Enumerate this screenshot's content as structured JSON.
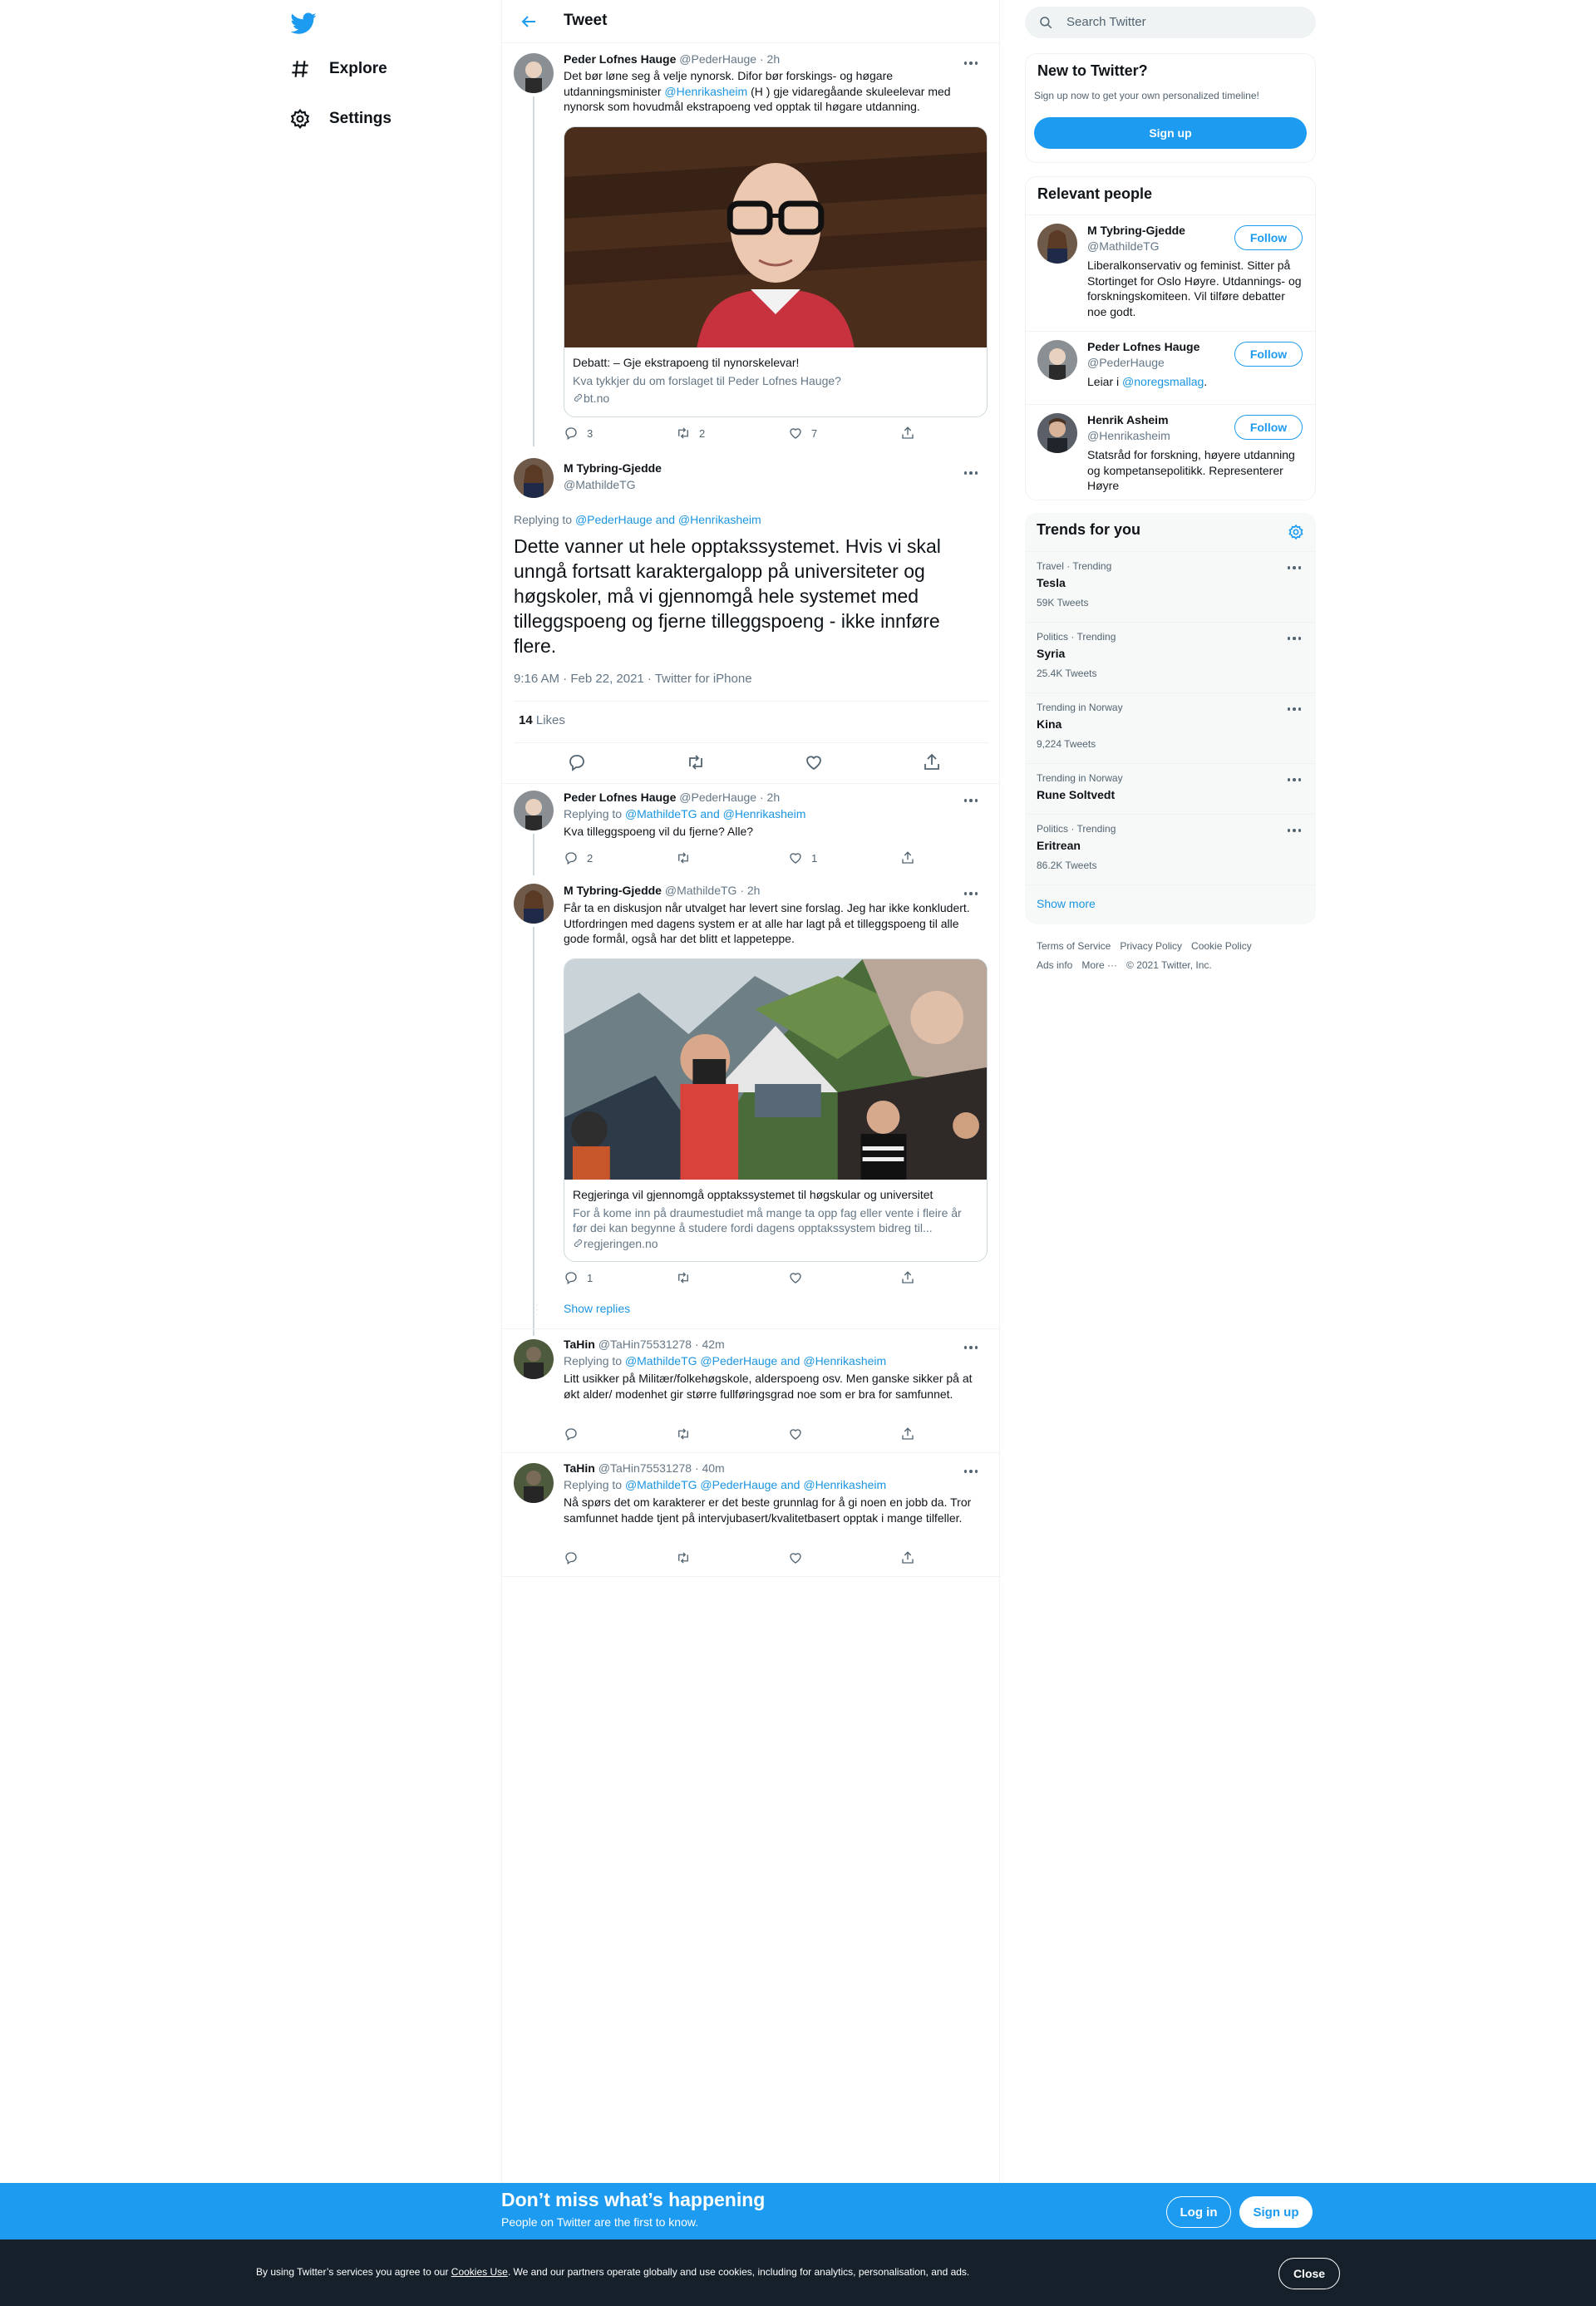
{
  "nav": {
    "logo": "twitter-bird-icon",
    "items": [
      {
        "label": "Explore",
        "icon": "hashtag-icon"
      },
      {
        "label": "Settings",
        "icon": "gear-icon"
      }
    ]
  },
  "header": {
    "title": "Tweet"
  },
  "parent_tweet": {
    "name": "Peder Lofnes Hauge",
    "handle": "@PederHauge",
    "time": "· 2h",
    "text_a": "Det bør løne seg å velje nynorsk. Difor bør forskings- og høgare utdanningsminister ",
    "mention": "@Henrikasheim",
    "text_b": " (H ) gje vidaregåande skuleelevar med nynorsk som hovudmål ekstrapoeng ved opptak til høgare utdanning.",
    "card": {
      "title": "Debatt: – Gje ekstrapoeng til nynorskelevar!",
      "description": "Kva tykkjer du om forslaget til Peder Lofnes Hauge?",
      "domain": "bt.no"
    },
    "replies": "3",
    "retweets": "2",
    "likes": "7"
  },
  "focused_tweet": {
    "name": "M Tybring-Gjedde",
    "handle": "@MathildeTG",
    "replying_prefix": "Replying to ",
    "replying_to": "@PederHauge and @Henrikasheim",
    "text": "Dette vanner ut hele opptakssystemet. Hvis vi skal unngå fortsatt karaktergalopp på universiteter og høgskoler, må vi gjennomgå hele systemet med tilleggspoeng og fjerne tilleggspoeng - ikke innføre flere.",
    "meta": "9:16 AM · Feb 22, 2021 · Twitter for iPhone",
    "likes_count": "14",
    "likes_label": " Likes"
  },
  "reply_1": {
    "name": "Peder Lofnes Hauge",
    "handle": "@PederHauge",
    "time": "· 2h",
    "replying_prefix": "Replying to ",
    "replying_to": "@MathildeTG and @Henrikasheim",
    "text": "Kva tilleggspoeng vil du fjerne? Alle?",
    "replies": "2",
    "likes": "1"
  },
  "reply_2": {
    "name": "M Tybring-Gjedde",
    "handle": "@MathildeTG",
    "time": "· 2h",
    "text": "Får ta en diskusjon når utvalget har levert sine forslag. Jeg har ikke konkludert. Utfordringen med dagens system er at alle har lagt på et tilleggspoeng til alle gode formål, også har det blitt et lappeteppe.",
    "card": {
      "title": "Regjeringa vil gjennomgå opptakssystemet til høgskular og universitet",
      "description": "For å kome inn på draumestudiet må mange ta opp fag eller vente i fleire år før dei kan begynne å studere fordi dagens opptakssystem bidreg til...",
      "domain": "regjeringen.no"
    },
    "replies": "1",
    "show_replies": "Show replies"
  },
  "reply_3": {
    "name": "TaHin",
    "handle": "@TaHin75531278",
    "time": "· 42m",
    "replying_prefix": "Replying to ",
    "replying_to": "@MathildeTG @PederHauge and @Henrikasheim",
    "text": "Litt usikker på Militær/folkehøgskole, alderspoeng osv. Men ganske sikker på at økt alder/ modenhet gir større fullføringsgrad noe som er bra for samfunnet."
  },
  "reply_4": {
    "name": "TaHin",
    "handle": "@TaHin75531278",
    "time": "· 40m",
    "replying_prefix": "Replying to ",
    "replying_to": "@MathildeTG @PederHauge and @Henrikasheim",
    "text": "Nå spørs det om karakterer er det beste grunnlag for å gi noen en jobb da. Tror samfunnet hadde tjent på intervjubasert/kvalitetbasert opptak i mange tilfeller."
  },
  "sidebar": {
    "search_placeholder": "Search Twitter",
    "new_to_twitter": {
      "title": "New to Twitter?",
      "subtitle": "Sign up now to get your own personalized timeline!",
      "button": "Sign up"
    },
    "relevant_people": {
      "title": "Relevant people",
      "follow_label": "Follow",
      "people": [
        {
          "name": "M Tybring-Gjedde",
          "handle": "@MathildeTG",
          "bio": "Liberalkonservativ og feminist. Sitter på Stortinget for Oslo Høyre. Utdannings- og forskningskomiteen. Vil tilføre debatter noe godt."
        },
        {
          "name": "Peder Lofnes Hauge",
          "handle": "@PederHauge",
          "bio_prefix": "Leiar i ",
          "bio_link": "@noregsmallag",
          "bio_suffix": "."
        },
        {
          "name": "Henrik Asheim",
          "handle": "@Henrikasheim",
          "bio": "Statsråd for forskning, høyere utdanning og kompetansepolitikk. Representerer Høyre"
        }
      ]
    },
    "trends": {
      "title": "Trends for you",
      "items": [
        {
          "context": "Travel · Trending",
          "name": "Tesla",
          "count": "59K Tweets"
        },
        {
          "context": "Politics · Trending",
          "name": "Syria",
          "count": "25.4K Tweets"
        },
        {
          "context": "Trending in Norway",
          "name": "Kina",
          "count": "9,224 Tweets"
        },
        {
          "context": "Trending in Norway",
          "name": "Rune Soltvedt",
          "count": ""
        },
        {
          "context": "Politics · Trending",
          "name": "Eritrean",
          "count": "86.2K Tweets"
        }
      ],
      "show_more": "Show more"
    },
    "footer": {
      "terms": "Terms of Service",
      "privacy": "Privacy Policy",
      "cookie": "Cookie Policy",
      "ads": "Ads info",
      "more": "More ···",
      "copyright": "© 2021 Twitter, Inc."
    }
  },
  "bottom_bar": {
    "title": "Don’t miss what’s happening",
    "subtitle": "People on Twitter are the first to know.",
    "login": "Log in",
    "signup": "Sign up"
  },
  "cookie_bar": {
    "text_a": "By using Twitter’s services you agree to our ",
    "link": "Cookies Use",
    "text_b": ". We and our partners operate globally and use cookies, including for analytics, personalisation, and ads.",
    "close": "Close"
  },
  "colors": {
    "accent": "#1d9bf0",
    "link": "#1b95e0",
    "text": "#0f1419",
    "muted": "#657786",
    "cookie_bg": "#15202b"
  }
}
